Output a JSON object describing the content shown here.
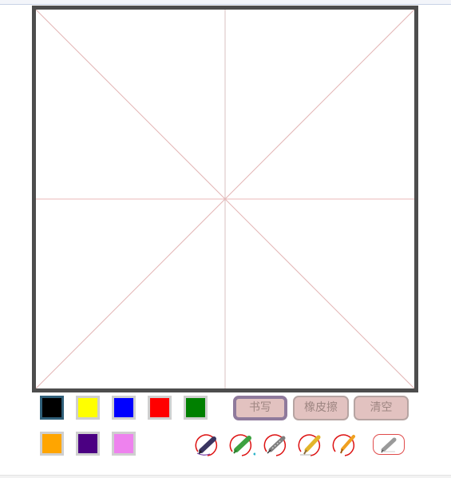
{
  "mode_buttons": {
    "write": "书写",
    "eraser": "橡皮擦",
    "clear": "清空"
  },
  "palette": {
    "selected": "black",
    "colors": [
      {
        "name": "black",
        "hex": "#000000"
      },
      {
        "name": "yellow",
        "hex": "#ffff00"
      },
      {
        "name": "blue",
        "hex": "#0000ff"
      },
      {
        "name": "red",
        "hex": "#ff0000"
      },
      {
        "name": "green",
        "hex": "#008000"
      },
      {
        "name": "orange",
        "hex": "#ffa500"
      },
      {
        "name": "indigo",
        "hex": "#4b0082"
      },
      {
        "name": "violet",
        "hex": "#ee82ee"
      }
    ]
  },
  "pen_tools": [
    "brush-pen-icon",
    "highlighter-pen-icon",
    "fountain-pen-icon",
    "pencil-icon",
    "crayon-pen-icon",
    "eraser-pencil-icon"
  ],
  "guide_colors": {
    "border": "#4d4d4d",
    "lines": "#e5b4b4"
  }
}
